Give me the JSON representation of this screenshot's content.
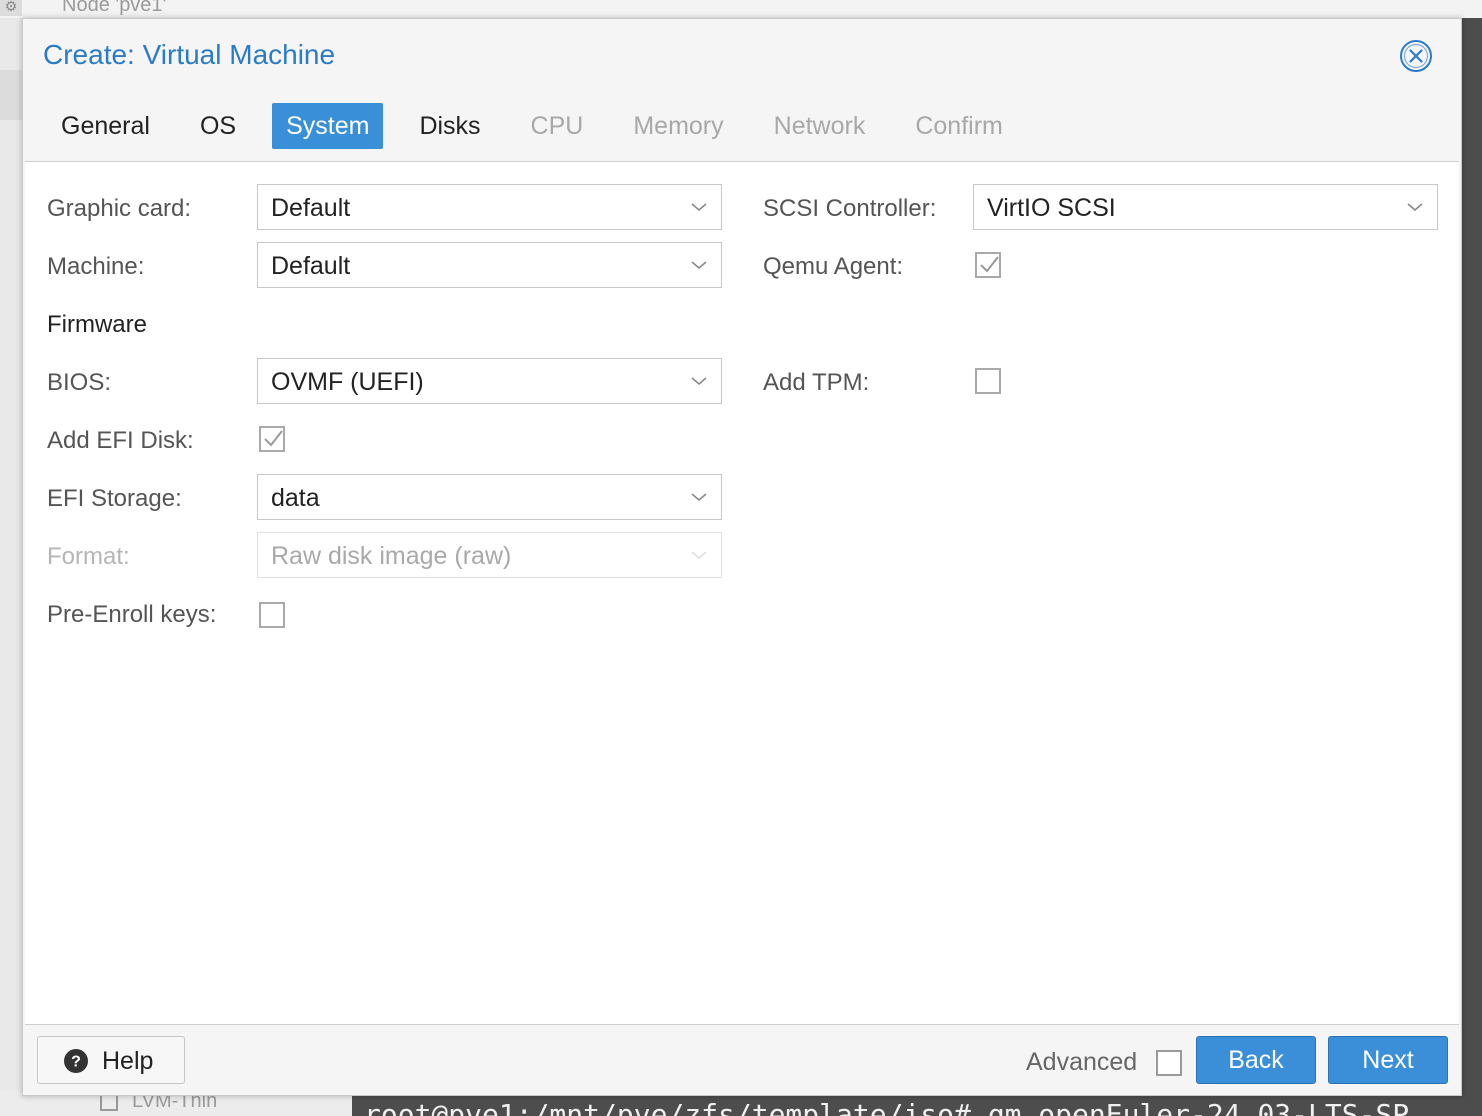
{
  "background": {
    "node_title": "Node 'pve1'",
    "tree_item": "LVM-Thin",
    "console_line": "root@pve1:/mnt/pve/zfs/template/iso# qm openEuler-24.03-LTS-SP"
  },
  "dialog": {
    "title": "Create: Virtual Machine",
    "tabs": [
      {
        "label": "General",
        "state": "enabled"
      },
      {
        "label": "OS",
        "state": "enabled"
      },
      {
        "label": "System",
        "state": "active"
      },
      {
        "label": "Disks",
        "state": "enabled"
      },
      {
        "label": "CPU",
        "state": "disabled"
      },
      {
        "label": "Memory",
        "state": "disabled"
      },
      {
        "label": "Network",
        "state": "disabled"
      },
      {
        "label": "Confirm",
        "state": "disabled"
      }
    ],
    "form": {
      "graphic_card": {
        "label": "Graphic card:",
        "value": "Default"
      },
      "machine": {
        "label": "Machine:",
        "value": "Default"
      },
      "firmware_heading": "Firmware",
      "bios": {
        "label": "BIOS:",
        "value": "OVMF (UEFI)"
      },
      "add_efi_disk": {
        "label": "Add EFI Disk:",
        "checked": true
      },
      "efi_storage": {
        "label": "EFI Storage:",
        "value": "data"
      },
      "format": {
        "label": "Format:",
        "value": "Raw disk image (raw)",
        "disabled": true
      },
      "pre_enroll_keys": {
        "label": "Pre-Enroll keys:",
        "checked": false
      },
      "scsi_controller": {
        "label": "SCSI Controller:",
        "value": "VirtIO SCSI"
      },
      "qemu_agent": {
        "label": "Qemu Agent:",
        "checked": true
      },
      "add_tpm": {
        "label": "Add TPM:",
        "checked": false
      }
    },
    "footer": {
      "help_label": "Help",
      "advanced_label": "Advanced",
      "advanced_checked": false,
      "back_label": "Back",
      "next_label": "Next"
    }
  },
  "colors": {
    "accent": "#3b8fd8",
    "title": "#2b7bc6",
    "disabled_text": "#a8a8a8"
  },
  "icons": [
    "close-icon",
    "chevron-down-icon",
    "checkmark-icon",
    "help-icon",
    "gear-icon"
  ]
}
